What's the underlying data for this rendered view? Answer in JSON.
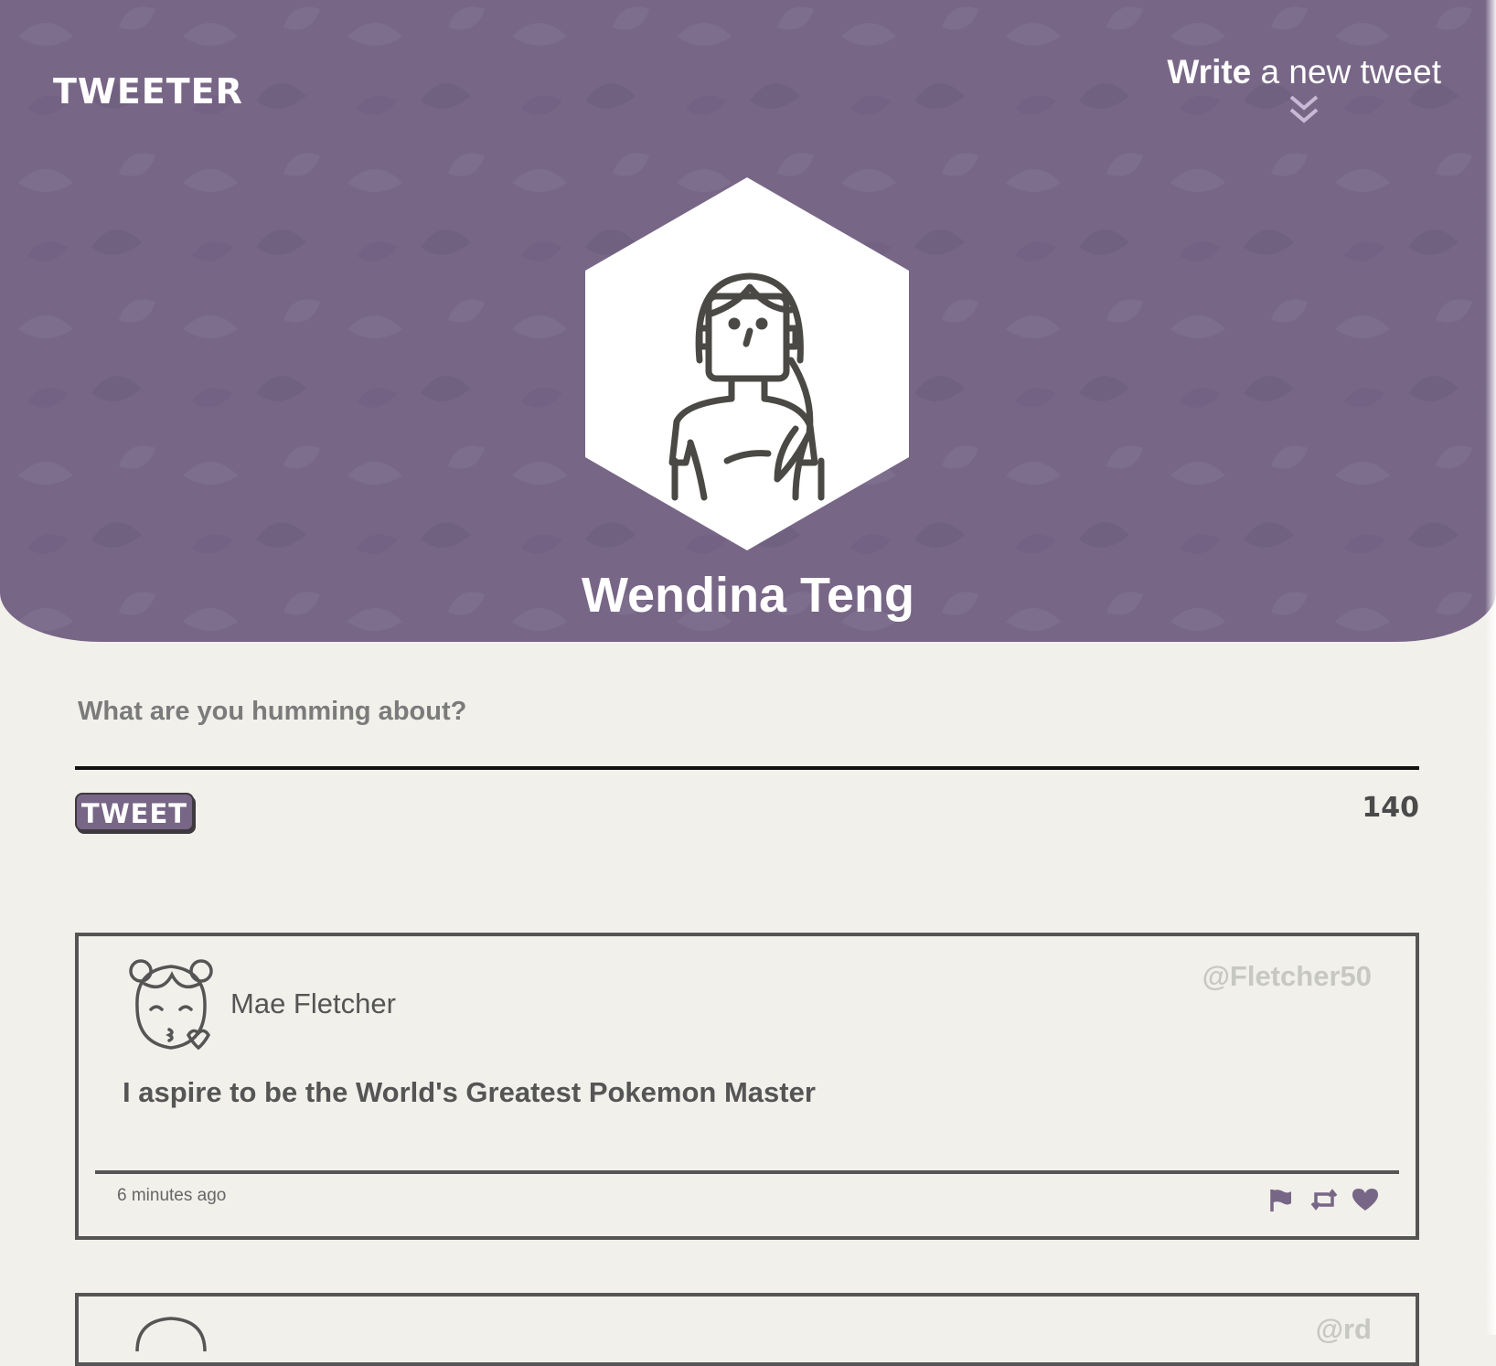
{
  "header": {
    "logo": "TWEETER",
    "compose_bold": "Write",
    "compose_rest": " a new tweet",
    "background_color": "#776686"
  },
  "profile": {
    "name": "Wendina Teng",
    "avatar_icon": "woman-avatar-icon"
  },
  "composer": {
    "prompt": "What are you humming about?",
    "button_label": "TWEET",
    "char_count": "140"
  },
  "tweets": [
    {
      "author": "Mae Fletcher",
      "handle": "@Fletcher50",
      "text": "I aspire to be the World's Greatest Pokemon Master",
      "time": "6 minutes ago",
      "avatar_icon": "girl-kiss-avatar-icon",
      "actions": [
        "flag-icon",
        "retweet-icon",
        "heart-icon"
      ]
    },
    {
      "handle": "@rd"
    }
  ]
}
